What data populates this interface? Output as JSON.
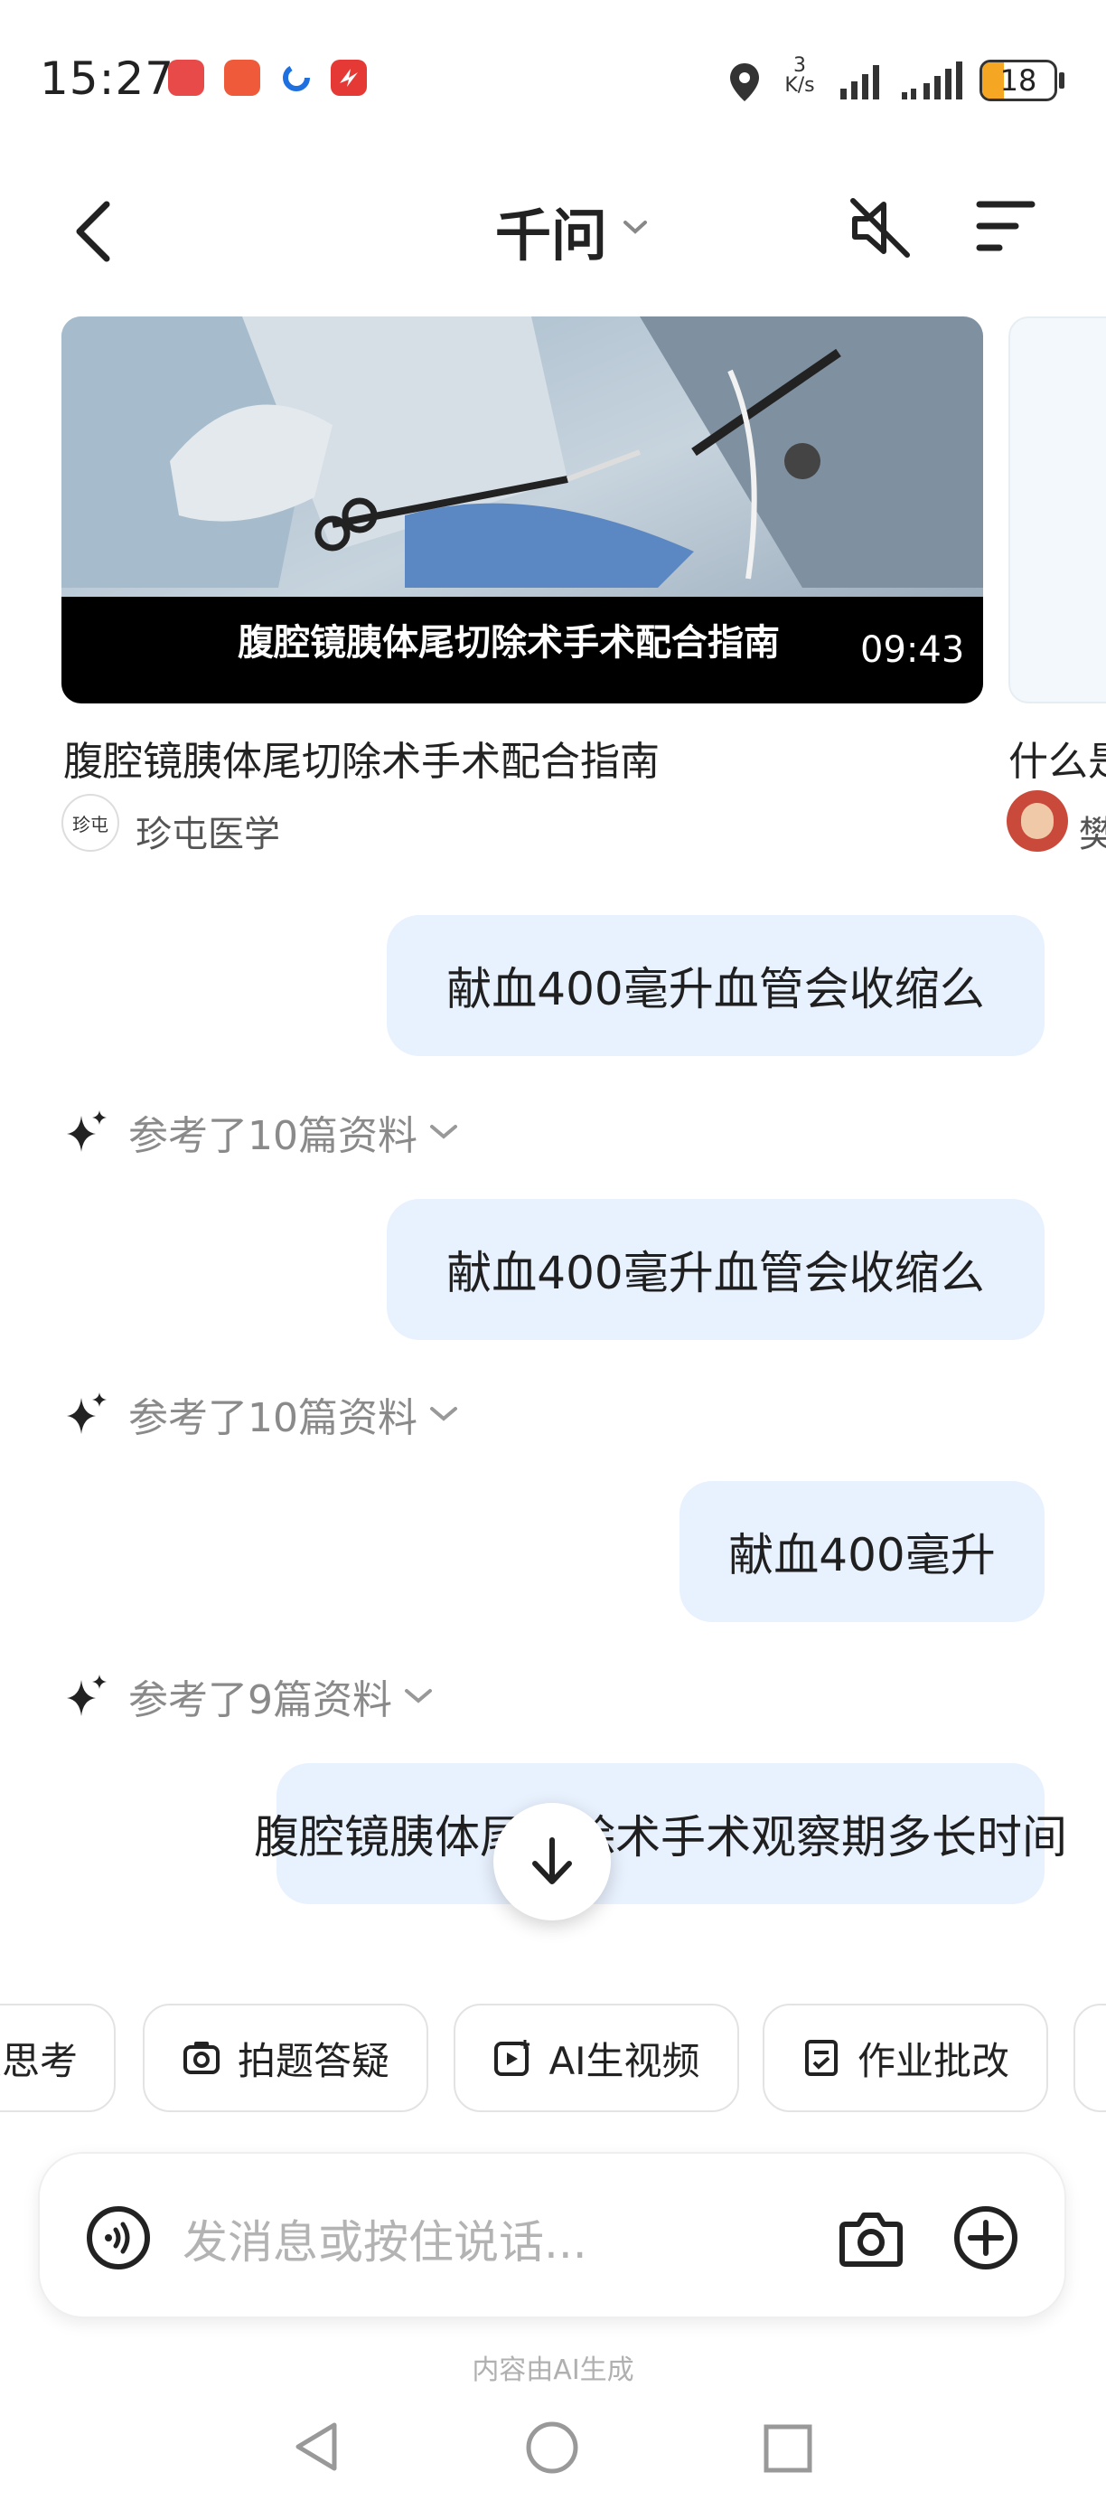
{
  "status_bar": {
    "time": "15:27",
    "network_speed_value": "3",
    "network_speed_unit": "K/s",
    "battery": "18"
  },
  "header": {
    "title": "千问"
  },
  "video_cards": [
    {
      "overlay_title": "腹腔镜胰体尾切除术手术配合指南",
      "duration": "09:43",
      "title": "腹腔镜胰体尾切除术手术配合指南",
      "source_logo_text": "珍屯",
      "source": "珍屯医学"
    },
    {
      "title": "什么是",
      "source": "樊"
    }
  ],
  "messages": [
    {
      "type": "user",
      "text": "献血400毫升血管会收缩么"
    },
    {
      "type": "ref",
      "text": "参考了10篇资料"
    },
    {
      "type": "user",
      "text": "献血400毫升血管会收缩么"
    },
    {
      "type": "ref",
      "text": "参考了10篇资料"
    },
    {
      "type": "user",
      "text": "献血400毫升"
    },
    {
      "type": "ref",
      "text": "参考了9篇资料"
    },
    {
      "type": "user",
      "text": "腹腔镜胰体尾切除术手术观察期多长时间"
    }
  ],
  "chips": [
    {
      "label": "深度思考",
      "icon": "think-icon"
    },
    {
      "label": "拍题答疑",
      "icon": "camera-question-icon"
    },
    {
      "label": "AI生视频",
      "icon": "video-plus-icon"
    },
    {
      "label": "作业批改",
      "icon": "homework-icon"
    }
  ],
  "input": {
    "placeholder": "发消息或按住说话..."
  },
  "footer_note": "内容由AI生成",
  "colors": {
    "bubble_bg": "#e8f1fe",
    "text_primary": "#1f1f1f",
    "text_secondary": "#8a8a8a"
  }
}
